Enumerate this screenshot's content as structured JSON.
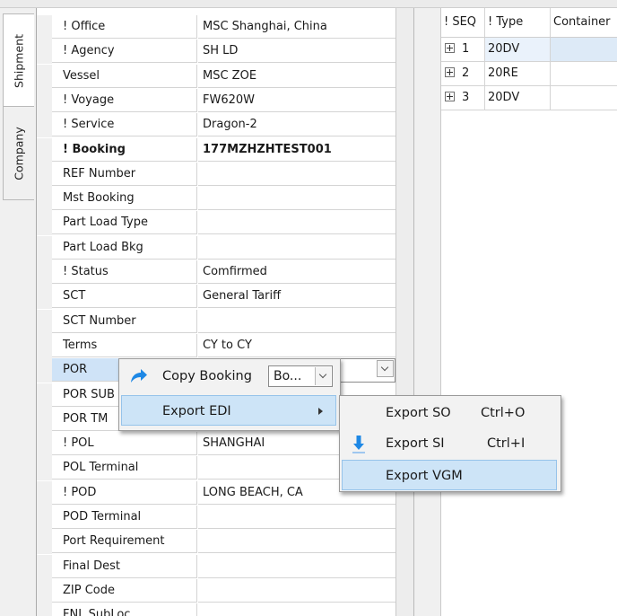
{
  "tabs": [
    "Shipment",
    "Company"
  ],
  "properties": [
    {
      "name": "! Office",
      "value": "MSC Shanghai, China"
    },
    {
      "name": "! Agency",
      "value": "SH LD"
    },
    {
      "name": "Vessel",
      "value": "MSC ZOE"
    },
    {
      "name": "! Voyage",
      "value": "FW620W"
    },
    {
      "name": "! Service",
      "value": "Dragon-2"
    },
    {
      "name": "! Booking",
      "value": "177MZHZHTEST001"
    },
    {
      "name": "REF Number",
      "value": ""
    },
    {
      "name": "Mst Booking",
      "value": ""
    },
    {
      "name": "Part Load Type",
      "value": ""
    },
    {
      "name": "Part Load Bkg",
      "value": ""
    },
    {
      "name": "! Status",
      "value": "Comfirmed"
    },
    {
      "name": "SCT",
      "value": "General Tariff"
    },
    {
      "name": "SCT Number",
      "value": ""
    },
    {
      "name": "Terms",
      "value": "CY to CY"
    },
    {
      "name": "POR",
      "value": ""
    },
    {
      "name": "POR SUB",
      "value": ""
    },
    {
      "name": "POR TM",
      "value": ""
    },
    {
      "name": "! POL",
      "value": "SHANGHAI"
    },
    {
      "name": "POL Terminal",
      "value": ""
    },
    {
      "name": "! POD",
      "value": "LONG BEACH, CA"
    },
    {
      "name": "POD Terminal",
      "value": ""
    },
    {
      "name": "Port Requirement",
      "value": ""
    },
    {
      "name": "Final Dest",
      "value": ""
    },
    {
      "name": "ZIP Code",
      "value": ""
    },
    {
      "name": "FNL SubLoc",
      "value": ""
    }
  ],
  "containers": {
    "columns": [
      "! SEQ",
      "! Type",
      "Container"
    ],
    "rows": [
      {
        "seq": "1",
        "type": "20DV"
      },
      {
        "seq": "2",
        "type": "20RE"
      },
      {
        "seq": "3",
        "type": "20DV"
      }
    ]
  },
  "context_menu": {
    "copy_label": "Copy Booking",
    "copy_combo_value": "Bo...",
    "export_edi_label": "Export EDI"
  },
  "submenu": {
    "items": [
      {
        "label": "Export SO",
        "shortcut": "Ctrl+O"
      },
      {
        "label": "Export SI",
        "shortcut": "Ctrl+I"
      },
      {
        "label": "Export VGM",
        "shortcut": ""
      }
    ]
  },
  "colors": {
    "selection": "#cfe3f7",
    "menu_highlight": "#cde4f7",
    "icon_blue": "#1e88e5"
  }
}
